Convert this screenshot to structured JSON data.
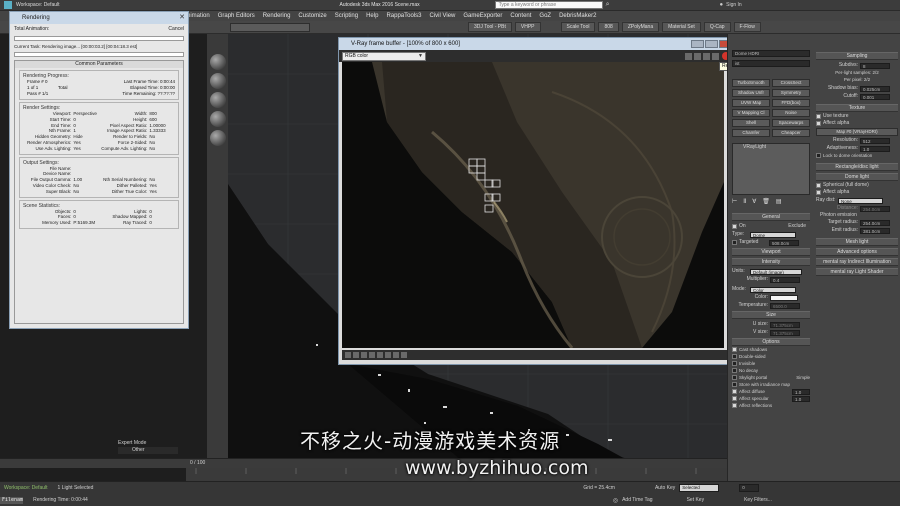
{
  "app": {
    "workspace": "Workspace: Default",
    "title": "Autodesk 3ds Max 2016    Scene.max",
    "search_placeholder": "Type a keyword or phrase",
    "sign_in": "Sign In"
  },
  "menu": [
    "nimation",
    "Graph Editors",
    "Rendering",
    "Customize",
    "Scripting",
    "Help",
    "RappaTools3",
    "Civil View",
    "GameExporter",
    "Content",
    "GoZ",
    "DebrisMaker2"
  ],
  "toolbar_right": [
    "3DJ Tool - PBt",
    "VHPP",
    "Scale Tool",
    "808",
    "ZPolyMana",
    "Material Set",
    "Q-Cap",
    "F-Flow"
  ],
  "rendering_window": {
    "title": "Rendering",
    "cancel": "Cancel",
    "total_animation": "Total Animation:",
    "current_task": "Current Task:   Rendering image...   [00:00:03.2] [00:04:18.3 est]",
    "common_parameters": "Common Parameters",
    "progress_title": "Rendering Progress:",
    "frame": "Frame #  0",
    "last_frame": "Last Frame Time:  0:00:44",
    "of": "1 of  1",
    "total": "Total",
    "elapsed": "Elapsed Time:  0:00:00",
    "pass": "Pass #  1/1",
    "remaining": "Time Remaining:  ??:??:??",
    "settings_title": "Render Settings:",
    "settings": [
      [
        "Viewport:",
        "Perspective",
        "Width:",
        "800"
      ],
      [
        "Start Time:",
        "0",
        "Height:",
        "600"
      ],
      [
        "End Time:",
        "0",
        "Pixel Aspect Ratio:",
        "1.00000"
      ],
      [
        "Nth Frame:",
        "1",
        "Image Aspect Ratio:",
        "1.33333"
      ],
      [
        "Hidden Geometry:",
        "Hide",
        "Render to Fields:",
        "No"
      ],
      [
        "Render Atmospherics:",
        "Yes",
        "Force 2-Sided:",
        "No"
      ],
      [
        "Use Adv. Lighting:",
        "Yes",
        "Compute Adv. Lighting:",
        "No"
      ]
    ],
    "output_title": "Output Settings:",
    "output": [
      [
        "File Name:",
        "",
        "",
        ""
      ],
      [
        "Device Name:",
        "",
        "",
        ""
      ],
      [
        "File Output Gamma:",
        "1.00",
        "Nth Serial Numbering:",
        "No"
      ],
      [
        "Video Color Check:",
        "No",
        "Dither Palleted:",
        "Yes"
      ],
      [
        "Super Black:",
        "No",
        "Dither True Color:",
        "Yes"
      ]
    ],
    "stats_title": "Scene Statistics:",
    "stats": [
      [
        "Objects:",
        "0",
        "Lights:",
        "0"
      ],
      [
        "Faces:",
        "0",
        "Shadow Mapped:",
        "0"
      ],
      [
        "Memory Used:",
        "P:5169.3M",
        "Ray Traced:",
        "0"
      ]
    ]
  },
  "vfb": {
    "title": "V-Ray frame buffer - [100% of 800 x 600]",
    "channel": "RGB color",
    "tooltip": "Render last"
  },
  "command_panel": {
    "modifier": "Dome HDRI",
    "list": "ist",
    "btns": [
      "TurboSmooth",
      "CrossSect",
      "Shadow Unfr",
      "Symmetry",
      "UVW Map",
      "FFD(box)",
      "V Mapping Cl",
      "Noise",
      "Shell",
      "Spacewarps",
      "Chamfer",
      "Cheapcer"
    ],
    "stack_item": "VRayLight",
    "general": "General",
    "on_label": "On",
    "exclude": "Exclude",
    "type_label": "Type:",
    "type_value": "Dome",
    "targeted": "Targeted",
    "target_value": "508.0cm",
    "viewport": "Viewport",
    "intensity": "Intensity",
    "units_label": "Units:",
    "units_value": "Default (image)",
    "multiplier_label": "Multiplier:",
    "multiplier_value": "0.4",
    "mode_label": "Mode:",
    "mode_value": "Color",
    "color_label": "Color:",
    "temperature_label": "Temperature:",
    "temperature_value": "6500.0",
    "size": "Size",
    "usize": "U size:",
    "usize_value": "71.375cm",
    "vsize": "V size:",
    "vsize_value": "71.375cm",
    "options": "Options",
    "opt_items": [
      "Cast shadows",
      "Double-sided",
      "Invisible",
      "No decay",
      "Skylight portal",
      "Store with irradiance map",
      "Affect diffuse",
      "Affect specular",
      "Affect reflections"
    ],
    "opt_simple": "Simple",
    "affect_diffuse_val": "1.0",
    "affect_specular_val": "1.0",
    "sampling": "Sampling",
    "subdivs": "Subdivs:",
    "subdivs_val": "8",
    "per_light": "Per-light samples:  2/2",
    "per_pixel": "Per pixel:  2/2",
    "shadow_bias": "Shadow bias:",
    "shadow_bias_val": "0.025cm",
    "cutoff": "Cutoff:",
    "cutoff_val": "0.001",
    "texture": "Texture",
    "use_texture": "Use texture",
    "affect_alpha": "Affect alpha",
    "map": "Map #0 (VRayHDRI)",
    "resolution": "Resolution:",
    "resolution_val": "512",
    "adaptiveness": "Adaptiveness:",
    "adaptiveness_val": "1.0",
    "lock_dome": "Lock to dome orientation",
    "rect_disc": "Rectangle/disc light",
    "dome_light": "Dome light",
    "spherical": "Spherical (full dome)",
    "affect_alpha2": "Affect alpha",
    "ray_dist": "Ray dist:",
    "ray_dist_val": "None",
    "distance": "Distance:",
    "distance_val": "254.0cm",
    "photon": "Photon emission",
    "target_radius": "Target radius:",
    "target_radius_val": "254.0cm",
    "emit_radius": "Emit radius:",
    "emit_radius_val": "381.0cm",
    "mesh_light": "Mesh light",
    "advanced": "Advanced options",
    "mr_indirect": "mental ray Indirect Illumination",
    "mr_shader": "mental ray Light Shader"
  },
  "status": {
    "expert": "Expert Mode",
    "other": "Other",
    "workspace": "Workspace: Default",
    "light_selected": "1 Light Selected",
    "rendering_time": "Rendering Time: 0:00:44",
    "filenam": "Filenam",
    "frame_counter": "0 / 100",
    "grid": "Grid = 25.4cm",
    "add_time_tag": "Add Time Tag",
    "auto_key": "Auto Key",
    "selected": "Selected",
    "set_key": "Set Key",
    "key_filters": "Key Filters...",
    "frame": "0"
  },
  "watermark": {
    "line1": "不移之火-动漫游戏美术资源",
    "line2": "www.byzhihuo.com"
  }
}
